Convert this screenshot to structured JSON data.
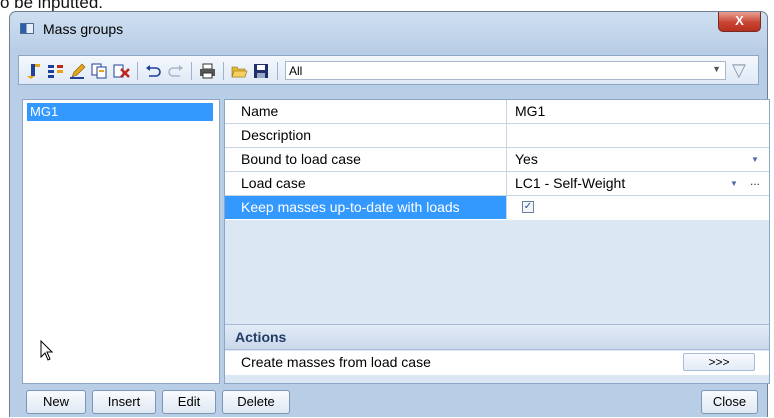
{
  "background_text": "o be inputted.",
  "window": {
    "title": "Mass groups",
    "close_label": "X"
  },
  "toolbar": {
    "icons": [
      "new-icon",
      "insert-icon",
      "edit-icon",
      "copy-icon",
      "delete-icon",
      "undo-icon",
      "redo-icon",
      "print-icon",
      "open-icon",
      "save-icon"
    ],
    "filter_value": "All",
    "filter_icon": "funnel-icon"
  },
  "list": {
    "items": [
      "MG1"
    ]
  },
  "properties": {
    "rows": [
      {
        "name": "Name",
        "value": "MG1"
      },
      {
        "name": "Description",
        "value": ""
      },
      {
        "name": "Bound to load case",
        "value": "Yes"
      },
      {
        "name": "Load case",
        "value": "LC1 - Self-Weight"
      },
      {
        "name": "Keep masses up-to-date with loads",
        "value": "checked"
      }
    ],
    "actions_header": "Actions",
    "action_label": "Create masses from load case",
    "action_button": ">>>"
  },
  "buttons": {
    "new": "New",
    "insert": "Insert",
    "edit": "Edit",
    "delete": "Delete",
    "close": "Close"
  },
  "colors": {
    "selection": "#3399ff",
    "window_frame": "#b8cde6",
    "close_button": "#c94432"
  }
}
